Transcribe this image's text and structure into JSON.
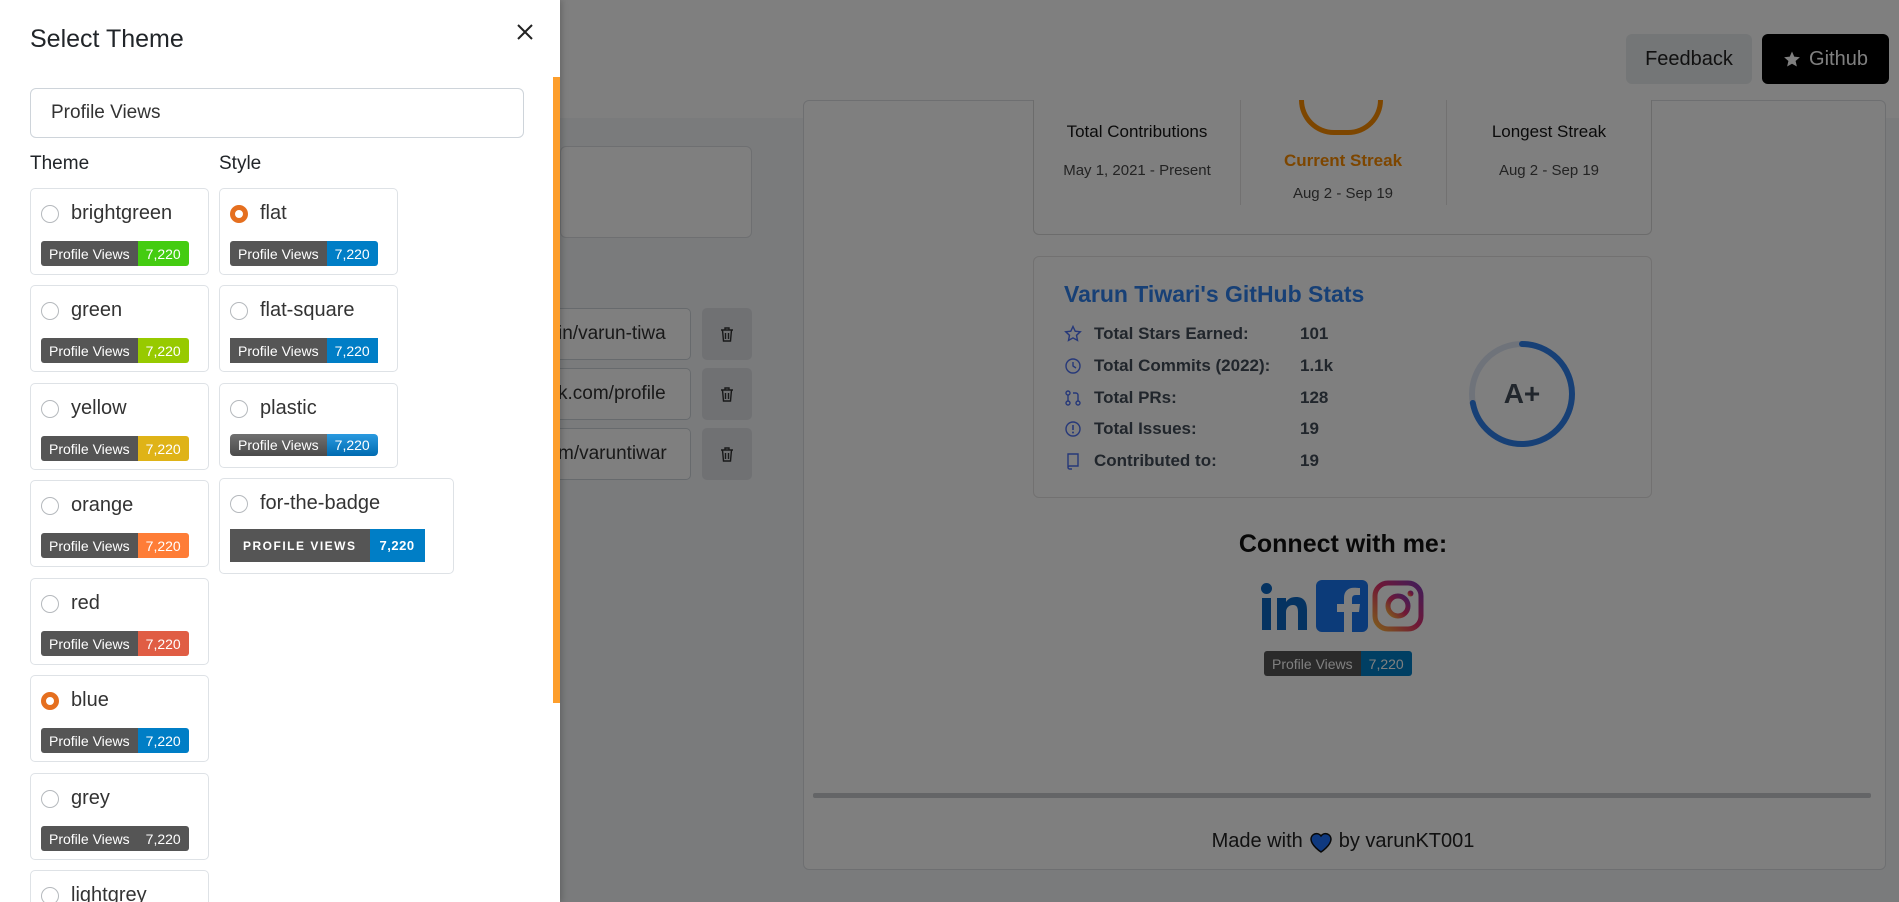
{
  "header": {
    "feedback_label": "Feedback",
    "github_label": "Github"
  },
  "background_form": {
    "url_values": [
      "in/varun-tiwa",
      "k.com/profile",
      "m/varuntiwar"
    ]
  },
  "streak": {
    "total_contributions_label": "Total Contributions",
    "total_contributions_range": "May 1, 2021 - Present",
    "current_streak_label": "Current Streak",
    "current_streak_range": "Aug 2 - Sep 19",
    "longest_streak_label": "Longest Streak",
    "longest_streak_range": "Aug 2 - Sep 19",
    "accent_color": "#fb8c00"
  },
  "stats": {
    "title": "Varun Tiwari's GitHub Stats",
    "rows": [
      {
        "icon": "star-icon",
        "label": "Total Stars Earned:",
        "value": "101"
      },
      {
        "icon": "history-icon",
        "label": "Total Commits (2022):",
        "value": "1.1k"
      },
      {
        "icon": "pull-request-icon",
        "label": "Total PRs:",
        "value": "128"
      },
      {
        "icon": "issue-icon",
        "label": "Total Issues:",
        "value": "19"
      },
      {
        "icon": "repo-icon",
        "label": "Contributed to:",
        "value": "19"
      }
    ],
    "rank": "A+",
    "rank_progress": 0.72,
    "accent_color": "#2f80ed"
  },
  "connect": {
    "title": "Connect with me:",
    "badge_label": "Profile Views",
    "badge_value": "7,220"
  },
  "footer": {
    "made_with": "Made with",
    "by": "by varunKT001"
  },
  "panel": {
    "title": "Select Theme",
    "input_value": "Profile Views",
    "theme_heading": "Theme",
    "style_heading": "Style",
    "badge_label": "Profile Views",
    "badge_value": "7,220",
    "ftb_label": "PROFILE VIEWS",
    "themes": [
      {
        "name": "brightgreen",
        "color": "#4c1",
        "checked": false
      },
      {
        "name": "green",
        "color": "#97ca00",
        "checked": false
      },
      {
        "name": "yellow",
        "color": "#dfb317",
        "checked": false
      },
      {
        "name": "orange",
        "color": "#fe7d37",
        "checked": false
      },
      {
        "name": "red",
        "color": "#e05d44",
        "checked": false
      },
      {
        "name": "blue",
        "color": "#007ec6",
        "checked": true
      },
      {
        "name": "grey",
        "color": "#555555",
        "checked": false
      },
      {
        "name": "lightgrey",
        "color": "#9f9f9f",
        "checked": false
      }
    ],
    "styles": [
      {
        "name": "flat",
        "checked": true
      },
      {
        "name": "flat-square",
        "checked": false
      },
      {
        "name": "plastic",
        "checked": false
      },
      {
        "name": "for-the-badge",
        "checked": false
      }
    ],
    "selected_radio_color": "#e56f1f"
  }
}
